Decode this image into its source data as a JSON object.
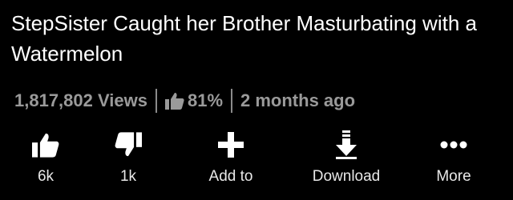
{
  "video": {
    "title": "StepSister Caught her Brother Masturbating with a Watermelon",
    "views": "1,817,802 Views",
    "rating": "81%",
    "age": "2 months ago"
  },
  "actions": {
    "like": {
      "label": "6k",
      "icon": "thumbs-up-icon"
    },
    "dislike": {
      "label": "1k",
      "icon": "thumbs-down-icon"
    },
    "add": {
      "label": "Add to",
      "icon": "plus-icon"
    },
    "download": {
      "label": "Download",
      "icon": "download-icon"
    },
    "more": {
      "label": "More",
      "icon": "more-dots-icon"
    }
  },
  "colors": {
    "background": "#000000",
    "meta_text": "#9a9a9a",
    "text": "#ffffff"
  }
}
